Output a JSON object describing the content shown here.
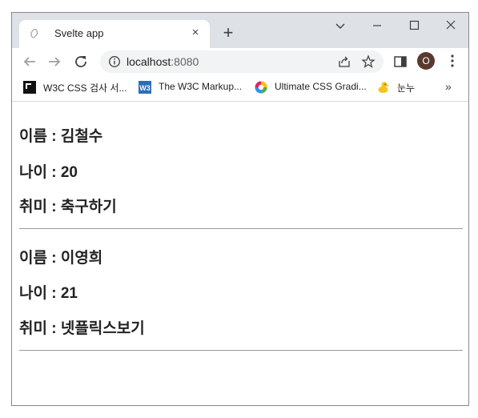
{
  "browser": {
    "tab": {
      "title": "Svelte app",
      "close_glyph": "×"
    },
    "new_tab_glyph": "+",
    "window_controls": {
      "dropdown": "⌄",
      "minimize": "–",
      "maximize": "☐",
      "close": "✕"
    },
    "address": {
      "host": "localhost",
      "port": ":8080"
    },
    "profile_initial": "O",
    "bookmarks": [
      {
        "label": "W3C CSS 검사 서...",
        "icon": "w3c-css-validator-icon"
      },
      {
        "label": "The W3C Markup...",
        "icon": "w3c-markup-icon"
      },
      {
        "label": "Ultimate CSS Gradi...",
        "icon": "color-wheel-icon"
      },
      {
        "label": "눈누",
        "icon": "duck-icon"
      }
    ],
    "bookmarks_overflow": "»"
  },
  "people": [
    {
      "name_line": "이름 : 김철수",
      "age_line": "나이 : 20",
      "hobby_line": "취미 : 축구하기"
    },
    {
      "name_line": "이름 : 이영희",
      "age_line": "나이 : 21",
      "hobby_line": "취미 : 넷플릭스보기"
    }
  ],
  "colors": {
    "tabstrip": "#dee1e6",
    "text": "#222222",
    "avatar": "#5a3a2e"
  }
}
